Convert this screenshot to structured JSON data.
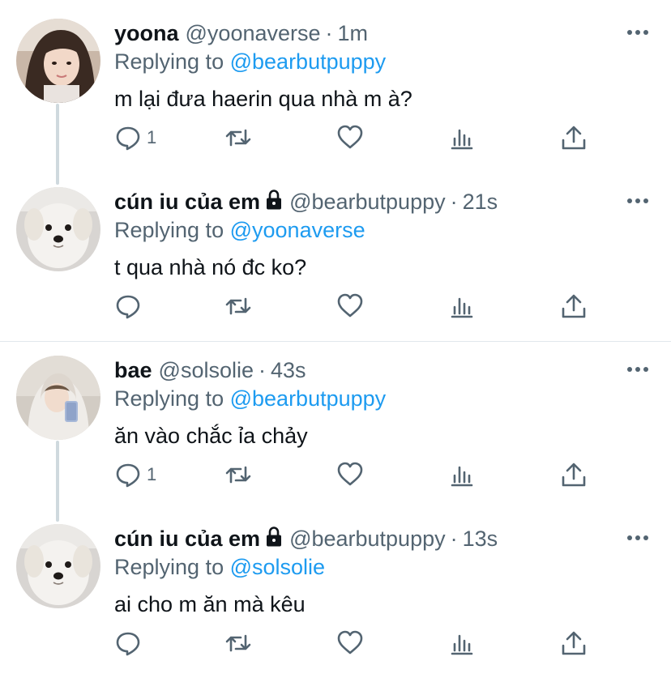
{
  "threads": [
    {
      "tweets": [
        {
          "display_name": "yoona",
          "locked": false,
          "handle": "@yoonaverse",
          "separator": "·",
          "time": "1m",
          "replying_prefix": "Replying to",
          "replying_to": "@bearbutpuppy",
          "text": "m lại đưa haerin qua nhà m à?",
          "reply_count": "1",
          "avatar": "girl-selfie-avatar"
        },
        {
          "display_name": "cún iu của em",
          "locked": true,
          "handle": "@bearbutpuppy",
          "separator": "·",
          "time": "21s",
          "replying_prefix": "Replying to",
          "replying_to": "@yoonaverse",
          "text": "t qua nhà nó đc ko?",
          "reply_count": "",
          "avatar": "white-puppy-avatar"
        }
      ]
    },
    {
      "tweets": [
        {
          "display_name": "bae",
          "locked": false,
          "handle": "@solsolie",
          "separator": "·",
          "time": "43s",
          "replying_prefix": "Replying to",
          "replying_to": "@bearbutpuppy",
          "text": "ăn vào chắc ỉa chảy",
          "reply_count": "1",
          "avatar": "hoodie-mirror-selfie-avatar"
        },
        {
          "display_name": "cún iu của em",
          "locked": true,
          "handle": "@bearbutpuppy",
          "separator": "·",
          "time": "13s",
          "replying_prefix": "Replying to",
          "replying_to": "@solsolie",
          "text": "ai cho m ăn mà kêu",
          "reply_count": "",
          "avatar": "white-puppy-avatar"
        }
      ]
    }
  ],
  "colors": {
    "text_primary": "#0f1419",
    "text_secondary": "#536471",
    "link": "#1d9bf0",
    "connector": "#cfd9de",
    "divider": "#e1e8ed"
  }
}
